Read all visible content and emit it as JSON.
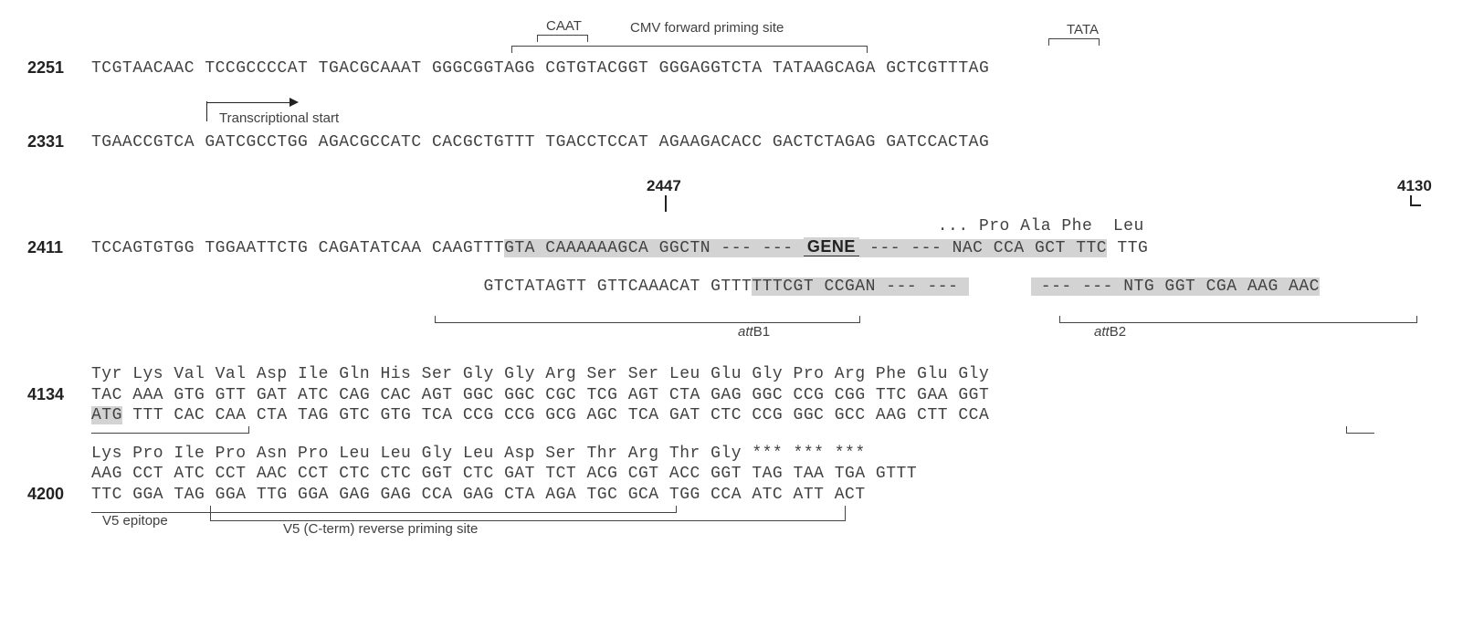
{
  "annotations": {
    "caat": "CAAT",
    "cmv_forward": "CMV forward priming site",
    "tata": "TATA",
    "transcriptional_start": "Transcriptional start",
    "attB1": "attB1",
    "attB2": "attB2",
    "gene": "GENE",
    "v5_epitope": "V5 epitope",
    "v5_reverse": "V5 (C-term) reverse priming site",
    "pos_2447": "2447",
    "pos_4130": "4130"
  },
  "rows": {
    "r2251": {
      "pos": "2251",
      "seq": "TCGTAACAAC TCCGCCCCAT TGACGCAAAT GGGCGGTAGG CGTGTACGGT GGGAGGTCTA TATAAGCAGA GCTCGTTTAG"
    },
    "r2331": {
      "pos": "2331",
      "seq": "TGAACCGTCA GATCGCCTGG AGACGCCATC CACGCTGTTT TGACCTCCAT AGAAGACACC GACTCTAGAG GATCCACTAG"
    },
    "r2411": {
      "pos": "2411",
      "aa": "                                                                                  ... Pro Ala Phe  Leu",
      "pre": "TCCAGTGTGG TGGAATTCTG CAGATATCAA CAAGTTT",
      "hl": "GTA CAAAAAAGCA GGCTN ",
      "dash": "--- --- ",
      "gene_dash": " --- --- ",
      "post": "NAC CCA GCT TTC",
      "tail": " TTG",
      "botpre": "                                GTCTATAGTT GTTCAAACAT GTTT",
      "bothl": "TTTCGT CCGAN ",
      "botdash": "--- --- ",
      "botdash2": " --- --- ",
      "botpost": "NTG GGT CGA AAG AAC"
    },
    "r4134": {
      "pos": "4134",
      "aa": "Tyr Lys Val Val Asp Ile Gln His Ser Gly Gly Arg Ser Ser Leu Glu Gly Pro Arg Phe Glu Gly",
      "top": "TAC AAA GTG GTT GAT ATC CAG CAC AGT GGC GGC CGC TCG AGT CTA GAG GGC CCG CGG TTC GAA GGT",
      "atg": "ATG",
      "bot": " TTT CAC CAA CTA TAG GTC GTG TCA CCG CCG GCG AGC TCA GAT CTC CCG GGC GCC AAG CTT CCA"
    },
    "r4200": {
      "pos": "4200",
      "aa": "Lys Pro Ile Pro Asn Pro Leu Leu Gly Leu Asp Ser Thr Arg Thr Gly *** *** ***",
      "top": "AAG CCT ATC CCT AAC CCT CTC CTC GGT CTC GAT TCT ACG CGT ACC GGT TAG TAA TGA GTTT",
      "bot": "TTC GGA TAG GGA TTG GGA GAG GAG CCA GAG CTA AGA TGC GCA TGG CCA ATC ATT ACT"
    }
  }
}
